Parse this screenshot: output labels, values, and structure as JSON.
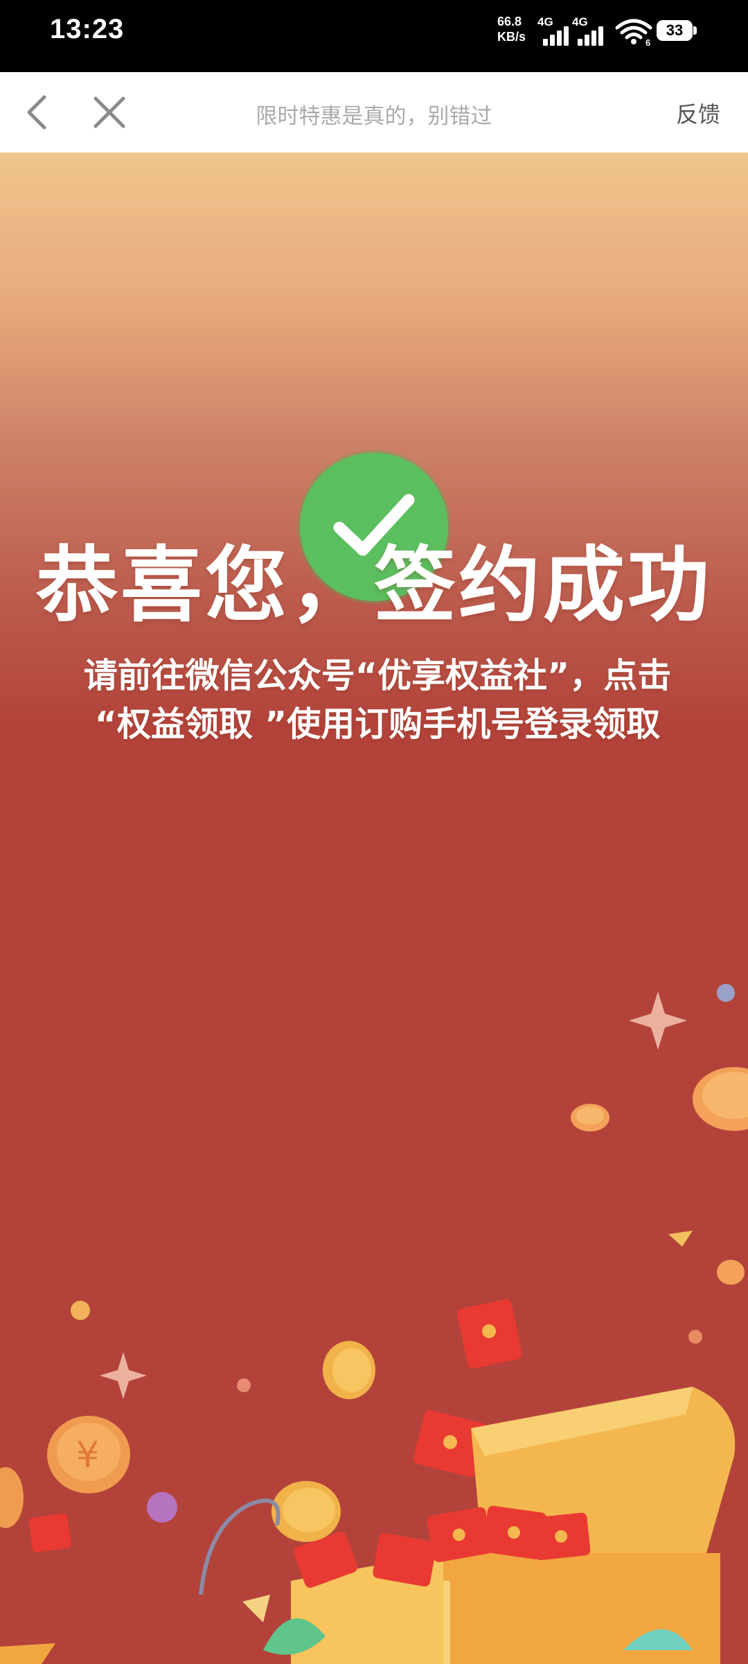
{
  "status_bar": {
    "time": "13:23",
    "net_speed_value": "66.8",
    "net_speed_unit": "KB/s",
    "sim1_label": "4G",
    "sim2_label": "4G",
    "wifi_badge": "6",
    "battery_level": "33"
  },
  "nav": {
    "title": "限时特惠是真的，别错过",
    "feedback_label": "反馈"
  },
  "content": {
    "success_title": "恭喜您，签约成功",
    "instruction_line1": "请前往微信公众号“优享权益社”，点击",
    "instruction_line2": "“权益领取 ”使用订购手机号登录领取"
  },
  "colors": {
    "success_green": "#5cbf5f",
    "hero_red": "#b3433a",
    "hero_gold": "#f0c58e"
  },
  "icons": [
    "back-icon",
    "close-icon",
    "check-icon",
    "wifi-icon",
    "signal-icon",
    "battery-icon"
  ]
}
